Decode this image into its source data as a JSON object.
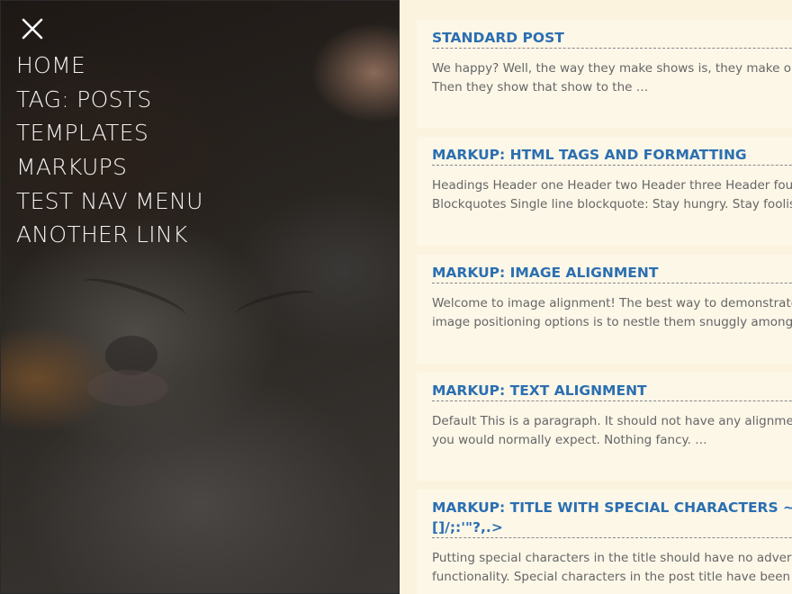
{
  "nav": {
    "close_icon": "close-icon",
    "items": [
      {
        "label": "HOME"
      },
      {
        "label": "TAG: POSTS"
      },
      {
        "label": "TEMPLATES"
      },
      {
        "label": "MARKUPS"
      },
      {
        "label": "TEST NAV MENU"
      },
      {
        "label": "ANOTHER LINK"
      }
    ]
  },
  "posts": [
    {
      "title": "STANDARD POST",
      "excerpt": [
        "We happy? Well, the way they make shows is, they make one show.",
        "Then they show that show to the …"
      ]
    },
    {
      "title": "MARKUP: HTML TAGS AND FORMATTING",
      "excerpt": [
        "Headings Header one Header two Header three Header four Header five",
        "Blockquotes Single line blockquote: Stay hungry. Stay foolish. Multi line"
      ]
    },
    {
      "title": "MARKUP: IMAGE ALIGNMENT",
      "excerpt": [
        "Welcome to image alignment! The best way to demonstrate the ebb and flow",
        "image positioning options is to nestle them snuggly among …"
      ]
    },
    {
      "title": "MARKUP: TEXT ALIGNMENT",
      "excerpt": [
        "Default This is a paragraph. It should not have any alignment of any kind.",
        "you would normally expect. Nothing fancy. …"
      ]
    },
    {
      "title_line1": "MARKUP: TITLE WITH SPECIAL CHARACTERS ~`!@#$%^&*()-_=+{}",
      "title_line2": "[]/;:'\"?,.>",
      "excerpt": [
        "Putting special characters in the title should have no adverse effect on the",
        "functionality. Special characters in the post title have been known to cause"
      ]
    }
  ],
  "colors": {
    "content_bg": "#fcf3df",
    "card_bg": "#fdf7e8",
    "title_color": "#2b6fb1",
    "excerpt_color": "#666666",
    "nav_text": "#f2f2f2"
  }
}
